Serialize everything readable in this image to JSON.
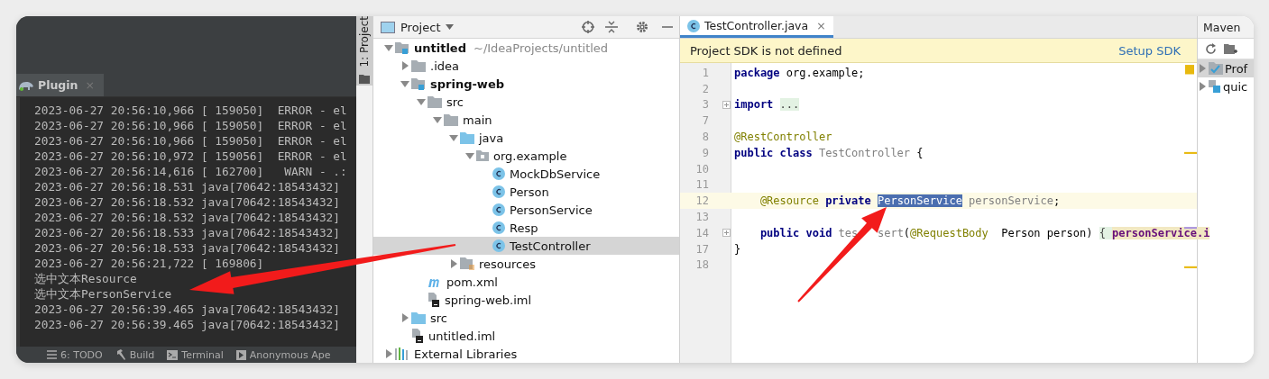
{
  "run_panel": {
    "tab": {
      "label": "Plugin",
      "close": "×",
      "selected": true
    },
    "console_lines": [
      "2023-06-27 20:56:10,966 [ 159050]  ERROR - el",
      "2023-06-27 20:56:10,966 [ 159050]  ERROR - el",
      "2023-06-27 20:56:10,966 [ 159050]  ERROR - el",
      "2023-06-27 20:56:10,972 [ 159056]  ERROR - el",
      "2023-06-27 20:56:14,616 [ 162700]   WARN - .:",
      "2023-06-27 20:56:18.531 java[70642:18543432]",
      "2023-06-27 20:56:18.532 java[70642:18543432]",
      "2023-06-27 20:56:18.532 java[70642:18543432]",
      "2023-06-27 20:56:18.533 java[70642:18543432]",
      "2023-06-27 20:56:18.533 java[70642:18543432]",
      "2023-06-27 20:56:21,722 [ 169806]",
      "选中文本Resource",
      "选中文本PersonService",
      "2023-06-27 20:56:39.465 java[70642:18543432]",
      "2023-06-27 20:56:39.465 java[70642:18543432]"
    ],
    "toolbar": [
      {
        "kind": "todo",
        "label": "6: TODO"
      },
      {
        "kind": "build",
        "label": "Build"
      },
      {
        "kind": "terminal",
        "label": "Terminal"
      },
      {
        "kind": "run",
        "label": "Anonymous Ape"
      }
    ]
  },
  "side_stripe": {
    "label": "1: Project",
    "selected": true
  },
  "project": {
    "title": "Project",
    "tree": [
      {
        "label": "untitled",
        "kind": "module",
        "hint": "~/IdeaProjects/untitled",
        "expanded": true,
        "selected": false,
        "children": [
          {
            "label": ".idea",
            "kind": "folder",
            "expanded": false,
            "selected": false
          },
          {
            "label": "spring-web",
            "kind": "module",
            "expanded": true,
            "selected": false,
            "children": [
              {
                "label": "src",
                "kind": "folder",
                "expanded": true,
                "selected": false,
                "children": [
                  {
                    "label": "main",
                    "kind": "folder",
                    "expanded": true,
                    "selected": false,
                    "children": [
                      {
                        "label": "java",
                        "kind": "source",
                        "expanded": true,
                        "selected": false,
                        "children": [
                          {
                            "label": "org.example",
                            "kind": "package",
                            "expanded": true,
                            "selected": false,
                            "children": [
                              {
                                "label": "MockDbService",
                                "kind": "class",
                                "selected": false
                              },
                              {
                                "label": "Person",
                                "kind": "class",
                                "selected": false
                              },
                              {
                                "label": "PersonService",
                                "kind": "class",
                                "selected": false
                              },
                              {
                                "label": "Resp",
                                "kind": "class",
                                "selected": false
                              },
                              {
                                "label": "TestController",
                                "kind": "class",
                                "selected": true
                              }
                            ]
                          }
                        ]
                      },
                      {
                        "label": "resources",
                        "kind": "resources",
                        "expanded": false,
                        "selected": false
                      }
                    ]
                  }
                ]
              },
              {
                "label": "pom.xml",
                "kind": "maven",
                "selected": false
              },
              {
                "label": "spring-web.iml",
                "kind": "iml",
                "selected": false
              }
            ]
          },
          {
            "label": "src",
            "kind": "source",
            "expanded": false,
            "selected": false
          },
          {
            "label": "untitled.iml",
            "kind": "iml",
            "selected": false
          }
        ]
      },
      {
        "label": "External Libraries",
        "kind": "libraries",
        "expanded": false,
        "selected": false
      }
    ]
  },
  "editor": {
    "tabs": [
      {
        "label": "TestController.java",
        "close": "×",
        "selected": true
      }
    ],
    "banner": {
      "message": "Project SDK is not defined",
      "action": "Setup SDK"
    },
    "lines": [
      {
        "number": "1",
        "current": false,
        "tokens": [
          {
            "kind": "keyword",
            "text": "package"
          },
          {
            "kind": "plain",
            "text": " org.example;"
          }
        ]
      },
      {
        "number": "2",
        "current": false
      },
      {
        "number": "3",
        "current": false,
        "fold": true,
        "tokens": [
          {
            "kind": "keyword",
            "text": "import "
          },
          {
            "kind": "folded",
            "text": "..."
          }
        ]
      },
      {
        "number": "7",
        "current": false
      },
      {
        "number": "8",
        "current": false,
        "tokens": [
          {
            "kind": "annotation",
            "text": "@RestController"
          }
        ]
      },
      {
        "number": "9",
        "current": false,
        "tokens": [
          {
            "kind": "keyword",
            "text": "public class "
          },
          {
            "kind": "unused",
            "text": "TestController"
          },
          {
            "kind": "plain",
            "text": " {"
          }
        ]
      },
      {
        "number": "10",
        "current": false
      },
      {
        "number": "11",
        "current": false
      },
      {
        "number": "12",
        "current": true,
        "indent": true,
        "tokens": [
          {
            "kind": "annotation",
            "text": "@Resource"
          },
          {
            "kind": "keyword",
            "text": " private "
          },
          {
            "kind": "selection",
            "text": "PersonService"
          },
          {
            "kind": "unused",
            "text": " personService"
          },
          {
            "kind": "plain",
            "text": ";"
          }
        ]
      },
      {
        "number": "13",
        "current": false
      },
      {
        "number": "14",
        "current": false,
        "fold": true,
        "indent": true,
        "tokens": [
          {
            "kind": "keyword",
            "text": "public void "
          },
          {
            "kind": "unused",
            "text": "tes"
          },
          {
            "kind": "gap"
          },
          {
            "kind": "unused",
            "text": "sert"
          },
          {
            "kind": "plain",
            "text": "("
          },
          {
            "kind": "annotation",
            "text": "@RequestBody"
          },
          {
            "kind": "plain",
            "text": "  Person person) "
          },
          {
            "kind": "folded",
            "text": "{ "
          },
          {
            "kind": "field",
            "text": "personService.i"
          }
        ]
      },
      {
        "number": "17",
        "current": false,
        "tokens": [
          {
            "kind": "plain",
            "text": "}"
          }
        ]
      },
      {
        "number": "18",
        "current": false
      }
    ]
  },
  "maven": {
    "title": "Maven",
    "tree": [
      {
        "label": "Prof",
        "kind": "profiles",
        "expanded": false,
        "selected": true
      },
      {
        "label": "quic",
        "kind": "project",
        "expanded": false,
        "selected": false
      }
    ]
  }
}
